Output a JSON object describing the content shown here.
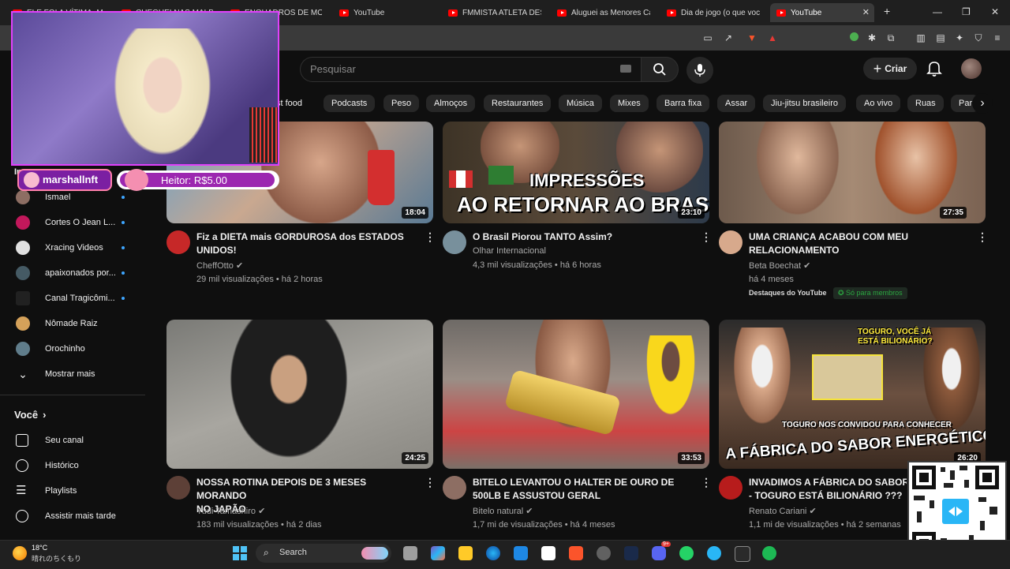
{
  "browser": {
    "tabs": [
      {
        "label": "ELE FOI A VÍTIMA, MAS"
      },
      {
        "label": "CHEGUEI NAS MALDIVAS"
      },
      {
        "label": "ENQUADROS DE MOTO"
      },
      {
        "label": "YouTube"
      },
      {
        "label": "FMMISTA ATLETA DESA"
      },
      {
        "label": "Aluguei as Menores Ca"
      },
      {
        "label": "Dia de jogo (o que voc"
      },
      {
        "label": "YouTube"
      }
    ],
    "new_tab": "+",
    "window_controls": {
      "minimize": "—",
      "maximize": "❐",
      "close": "✕"
    }
  },
  "header": {
    "search_placeholder": "Pesquisar",
    "create_label": "Criar"
  },
  "chips": [
    "st food",
    "Podcasts",
    "Peso",
    "Almoços",
    "Restaurantes",
    "Música",
    "Mixes",
    "Barra fixa",
    "Assar",
    "Jiu-jitsu brasileiro",
    "Ao vivo",
    "Ruas",
    "Par"
  ],
  "overlay": {
    "streamer_tag": "marshallnft",
    "donation": "Heitor: R$5.00"
  },
  "sidebar": {
    "section_partial": "In...",
    "subscriptions": [
      {
        "label": "Ismael",
        "color": "#8d6e63"
      },
      {
        "label": "Cortes O Jean L...",
        "color": "#c2185b"
      },
      {
        "label": "Xracing Videos",
        "color": "#e0e0e0"
      },
      {
        "label": "apaixonados por...",
        "color": "#455a64"
      },
      {
        "label": "Canal Tragicômi...",
        "color": "#212121"
      },
      {
        "label": "Nômade Raiz",
        "color": "#d4a15a"
      },
      {
        "label": "Orochinho",
        "color": "#607d8b"
      }
    ],
    "show_more": "Mostrar mais",
    "you_label": "Você",
    "you_items": [
      {
        "label": "Seu canal"
      },
      {
        "label": "Histórico"
      },
      {
        "label": "Playlists"
      },
      {
        "label": "Assistir mais tarde"
      }
    ]
  },
  "videos": [
    {
      "title1": "Fiz a DIETA mais GORDUROSA dos ESTADOS",
      "title2": "UNIDOS!",
      "channel": "CheffOtto",
      "meta": "29 mil visualizações • há 2 horas",
      "duration": "18:04",
      "avatar_color": "#c62828"
    },
    {
      "title1": "O Brasil Piorou TANTO Assim?",
      "title2": "",
      "channel": "Olhar Internacional",
      "meta": "4,3 mil visualizações • há 6 horas",
      "duration": "23:10",
      "avatar_color": "#78909c",
      "thumb_text1": "IMPRESSÕES",
      "thumb_text2": "AO RETORNAR AO BRASIL"
    },
    {
      "title1": "UMA CRIANÇA ACABOU COM MEU",
      "title2": "RELACIONAMENTO",
      "channel": "Beta Boechat",
      "meta": "há 4 meses",
      "duration": "27:35",
      "avatar_color": "#d7a98c",
      "badge1": "Destaques do YouTube",
      "badge2": "Só para membros"
    },
    {
      "title1": "NOSSA ROTINA DEPOIS DE 3 MESES MORANDO",
      "title2": "NO JAPÃO",
      "channel": "Yudi Tamashiro",
      "meta": "183 mil visualizações • há 2 dias",
      "duration": "24:25",
      "avatar_color": "#5d4037"
    },
    {
      "title1": "BITELO LEVANTOU O HALTER DE OURO DE",
      "title2": "500LB E ASSUSTOU GERAL",
      "channel": "Bitelo natural",
      "meta": "1,7 mi de visualizações • há 4 meses",
      "duration": "33:53",
      "avatar_color": "#8d6e63"
    },
    {
      "title1": "INVADIMOS A FÁBRICA DO SABOR",
      "title2": "- TOGURO ESTÁ BILIONÁRIO ???",
      "channel": "Renato Cariani",
      "meta": "1,1 mi de visualizações • há 2 semanas",
      "duration": "26:20",
      "avatar_color": "#b71c1c",
      "thumb_text1": "TOGURO NOS CONVIDOU PARA CONHECER",
      "thumb_text2": "A FÁBRICA DO SABOR ENERGÉTICO !",
      "thumb_text3": "TOGURO, VOCÊ JÁ",
      "thumb_text4": "ESTÁ BILIONÁRIO?"
    }
  ],
  "taskbar": {
    "temperature": "18°C",
    "weather": "晴れのちくもり",
    "search_label": "Search",
    "notif_count": "9+"
  }
}
